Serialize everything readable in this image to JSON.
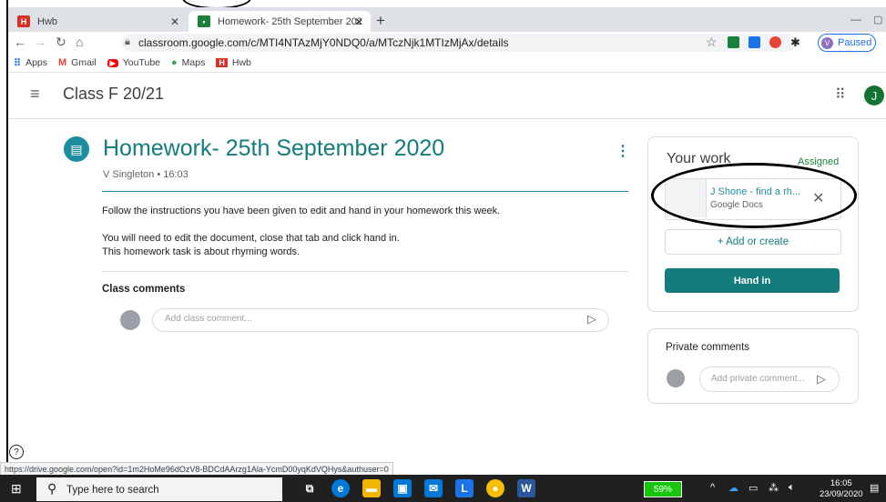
{
  "browser": {
    "tabs": [
      {
        "title": "Hwb",
        "icon": "H"
      },
      {
        "title": "Homework- 25th September 202"
      }
    ],
    "new_tab": "+",
    "minimize": "—",
    "maximize": "▢",
    "url": "classroom.google.com/c/MTI4NTAzMjY0NDQ0/a/MTczNjk1MTIzMjAx/details",
    "profile_status": "Paused",
    "profile_initial": "V",
    "bookmarks": [
      {
        "label": "Apps",
        "icon": "apps-grid-icon"
      },
      {
        "label": "Gmail",
        "icon": "M"
      },
      {
        "label": "YouTube",
        "icon": "▶"
      },
      {
        "label": "Maps",
        "icon": "maps-pin-icon"
      },
      {
        "label": "Hwb",
        "icon": "H"
      }
    ]
  },
  "header": {
    "class_name": "Class F 20/21",
    "user_initial": "J"
  },
  "assignment": {
    "title": "Homework- 25th September 2020",
    "meta": "V Singleton • 16:03",
    "instructions": [
      "Follow the instructions you have been given to edit and hand in your homework this week.",
      "You will need to edit the document, close that tab and click hand in.",
      "This homework task is about rhyming words."
    ],
    "class_comments_label": "Class comments",
    "comment_placeholder": "Add class comment..."
  },
  "your_work": {
    "title": "Your work",
    "status": "Assigned",
    "attachment_name": "J Shone - find a rh...",
    "attachment_type": "Google Docs",
    "add_create": "+ Add or create",
    "hand_in": "Hand in"
  },
  "private_comments": {
    "label": "Private comments",
    "placeholder": "Add private comment..."
  },
  "status_link": "https://drive.google.com/open?id=1m2HoMe96dOzV8-BDCdAArzg1Ala-YcmD00yqKdVQHys&authuser=0",
  "taskbar": {
    "search_placeholder": "Type here to search",
    "battery": "59%",
    "time": "16:05",
    "date": "23/09/2020"
  },
  "colors": {
    "accent": "#137c7c",
    "assigned": "#188038",
    "avatar": "#137333"
  }
}
